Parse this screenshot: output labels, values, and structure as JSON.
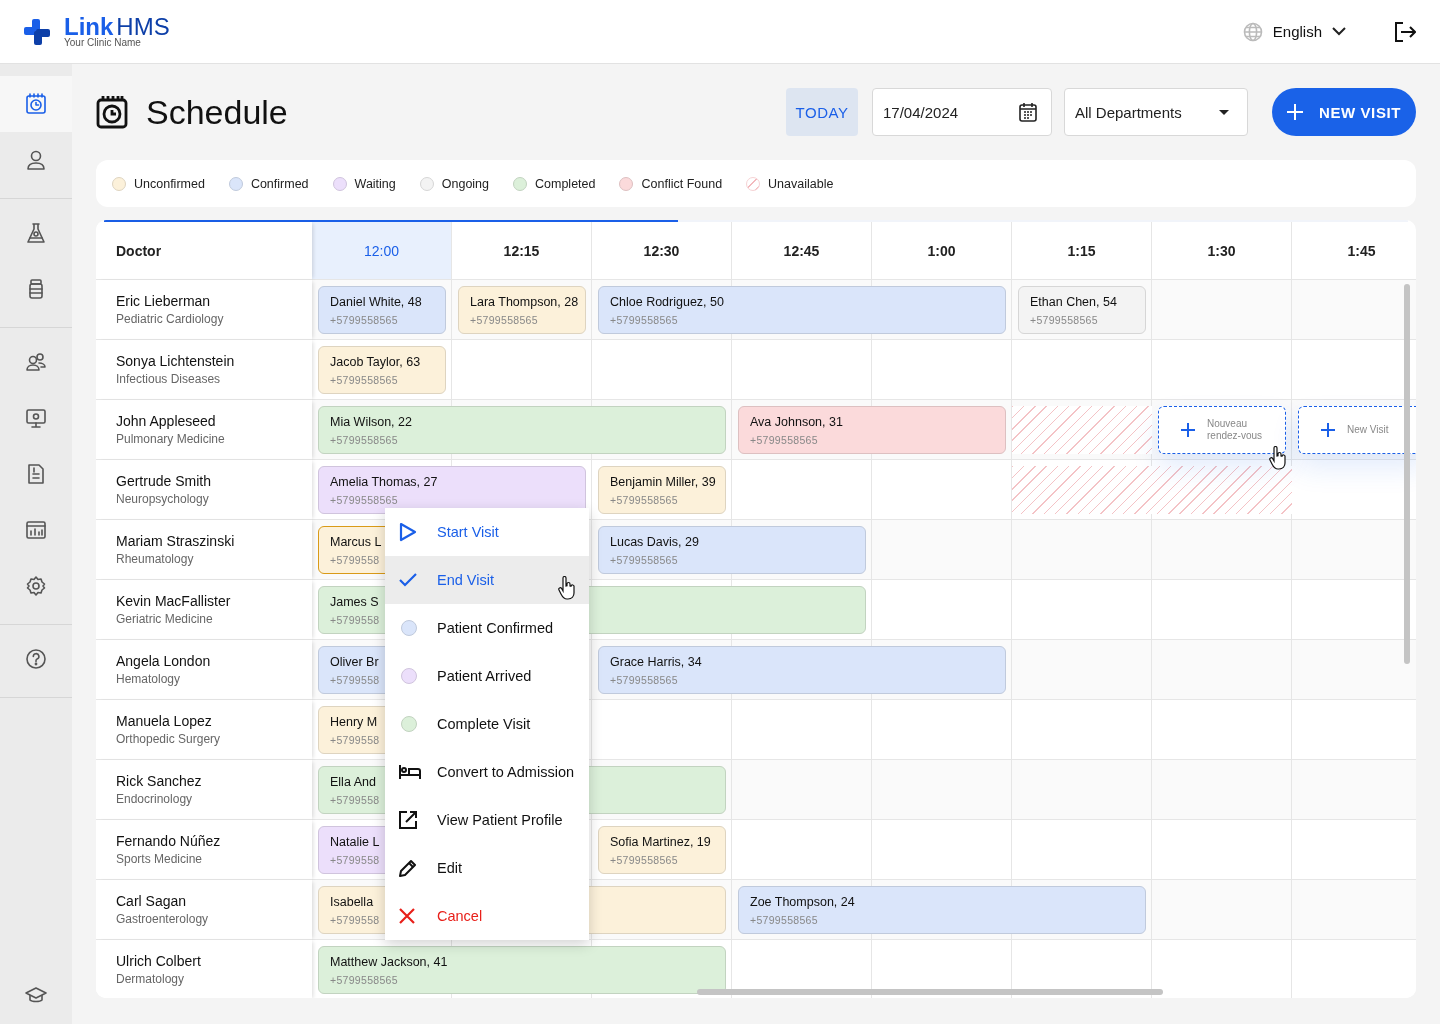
{
  "brand": {
    "name": "Link",
    "suffix": "HMS",
    "subtitle": "Your Clinic Name"
  },
  "header": {
    "language": "English"
  },
  "sidebar": {
    "groups": [
      [
        {
          "kind": "schedule",
          "selected": true
        },
        {
          "kind": "patients",
          "selected": false
        }
      ],
      [
        {
          "kind": "lab",
          "selected": false
        },
        {
          "kind": "medicine",
          "selected": false
        }
      ],
      [
        {
          "kind": "staff",
          "selected": false
        },
        {
          "kind": "monitor",
          "selected": false
        },
        {
          "kind": "billing",
          "selected": false
        },
        {
          "kind": "reports",
          "selected": false
        },
        {
          "kind": "settings",
          "selected": false
        }
      ],
      [
        {
          "kind": "help",
          "selected": false
        }
      ]
    ],
    "footer": {
      "kind": "academy"
    }
  },
  "page": {
    "title": "Schedule",
    "today_button": "TODAY",
    "date": "17/04/2024",
    "department": "All Departments",
    "new_visit_button": "NEW VISIT"
  },
  "legend": [
    {
      "kind": "solid",
      "color": "#fcf1da",
      "label": "Unconfirmed"
    },
    {
      "kind": "solid",
      "color": "#dae5fa",
      "label": "Confirmed"
    },
    {
      "kind": "solid",
      "color": "#ecdffb",
      "label": "Waiting"
    },
    {
      "kind": "solid",
      "color": "#f3f3f3",
      "label": "Ongoing"
    },
    {
      "kind": "solid",
      "color": "#dcf0da",
      "label": "Completed"
    },
    {
      "kind": "solid",
      "color": "#fbdadb",
      "label": "Conflict Found"
    },
    {
      "kind": "hatched",
      "label": "Unavailable"
    }
  ],
  "schedule": {
    "progress": {
      "level": 0.44
    },
    "doctor_column": "Doctor",
    "columns": [
      {
        "label": "12:00",
        "selected": true
      },
      {
        "label": "12:15",
        "selected": false
      },
      {
        "label": "12:30",
        "selected": false
      },
      {
        "label": "12:45",
        "selected": false
      },
      {
        "label": "1:00",
        "selected": false
      },
      {
        "label": "1:15",
        "selected": false
      },
      {
        "label": "1:30",
        "selected": false
      },
      {
        "label": "1:45",
        "selected": false
      }
    ],
    "rows": [
      {
        "doctor": "Eric Lieberman",
        "specialty": "Pediatric Cardiology",
        "cells": [
          {
            "kind": "appointment",
            "color": "#dae5fa",
            "patient": "Daniel White, 48",
            "phone": "+5799558565",
            "selected": false
          },
          {
            "kind": "appointment",
            "color": "#fcf1da",
            "patient": "Lara Thompson, 28",
            "phone": "+5799558565",
            "selected": false
          },
          {
            "kind": "appointment",
            "color": "#dae5fa",
            "patient": "Chloe Rodriguez, 50",
            "phone": "+5799558565",
            "selected": false
          },
          {
            "kind": "continued"
          },
          {
            "kind": "continued"
          },
          {
            "kind": "appointment",
            "color": "#f3f3f3",
            "patient": "Ethan Chen, 54",
            "phone": "+5799558565",
            "selected": false
          }
        ]
      },
      {
        "doctor": "Sonya Lichtenstein",
        "specialty": "Infectious Diseases",
        "cells": [
          {
            "kind": "appointment",
            "color": "#fcf1da",
            "patient": "Jacob Taylor, 63",
            "phone": "+5799558565",
            "selected": false
          }
        ]
      },
      {
        "doctor": "John Appleseed",
        "specialty": "Pulmonary Medicine",
        "cells": [
          {
            "kind": "appointment",
            "color": "#dcf0da",
            "patient": "Mia Wilson, 22",
            "phone": "+5799558565",
            "selected": false
          },
          {
            "kind": "continued"
          },
          {
            "kind": "continued"
          },
          {
            "kind": "appointment",
            "color": "#fbdadb",
            "patient": "Ava Johnson, 31",
            "phone": "+5799558565",
            "selected": false
          },
          {
            "kind": "continued"
          },
          {
            "kind": "unavailable"
          },
          {
            "kind": "new",
            "label": "Nouveau rendez-vous"
          },
          {
            "kind": "new",
            "label": "New Visit"
          }
        ]
      },
      {
        "doctor": "Gertrude Smith",
        "specialty": "Neuropsychology",
        "cells": [
          {
            "kind": "appointment",
            "color": "#ecdffb",
            "patient": "Amelia Thomas, 27",
            "phone": "+5799558565",
            "selected": false
          },
          {
            "kind": "continued"
          },
          {
            "kind": "appointment",
            "color": "#fcf1da",
            "patient": "Benjamin Miller, 39",
            "phone": "+5799558565",
            "selected": false
          },
          {
            "kind": "empty"
          },
          {
            "kind": "empty"
          },
          {
            "kind": "unavailable"
          },
          {
            "kind": "continued"
          }
        ]
      },
      {
        "doctor": "Mariam Straszinski",
        "specialty": "Rheumatology",
        "cells": [
          {
            "kind": "appointment",
            "color": "#fcf1da",
            "patient": "Marcus L",
            "phone": "+5799558",
            "selected": true
          },
          {
            "kind": "continued"
          },
          {
            "kind": "appointment",
            "color": "#dae5fa",
            "patient": "Lucas Davis, 29",
            "phone": "+5799558565",
            "selected": false
          },
          {
            "kind": "continued"
          }
        ]
      },
      {
        "doctor": "Kevin MacFallister",
        "specialty": "Geriatric Medicine",
        "cells": [
          {
            "kind": "appointment",
            "color": "#dcf0da",
            "patient": "James S",
            "phone": "+5799558",
            "selected": false
          },
          {
            "kind": "continued"
          },
          {
            "kind": "continued"
          },
          {
            "kind": "continued"
          }
        ]
      },
      {
        "doctor": "Angela London",
        "specialty": "Hematology",
        "cells": [
          {
            "kind": "appointment",
            "color": "#dae5fa",
            "patient": "Oliver Br",
            "phone": "+5799558",
            "selected": false
          },
          {
            "kind": "continued"
          },
          {
            "kind": "appointment",
            "color": "#dae5fa",
            "patient": "Grace Harris, 34",
            "phone": "+5799558565",
            "selected": false
          },
          {
            "kind": "continued"
          },
          {
            "kind": "continued"
          }
        ]
      },
      {
        "doctor": "Manuela Lopez",
        "specialty": "Orthopedic Surgery",
        "cells": [
          {
            "kind": "appointment",
            "color": "#fcf1da",
            "patient": "Henry M",
            "phone": "+5799558",
            "selected": false
          },
          {
            "kind": "continued"
          }
        ]
      },
      {
        "doctor": "Rick Sanchez",
        "specialty": "Endocrinology",
        "cells": [
          {
            "kind": "appointment",
            "color": "#dcf0da",
            "patient": "Ella And",
            "phone": "+5799558",
            "selected": false
          },
          {
            "kind": "continued"
          },
          {
            "kind": "continued"
          }
        ]
      },
      {
        "doctor": "Fernando Núñez",
        "specialty": "Sports Medicine",
        "cells": [
          {
            "kind": "appointment",
            "color": "#ecdffb",
            "patient": "Natalie L",
            "phone": "+5799558",
            "selected": false
          },
          {
            "kind": "continued"
          },
          {
            "kind": "appointment",
            "color": "#fcf1da",
            "patient": "Sofia Martinez, 19",
            "phone": "+5799558565",
            "selected": false
          }
        ]
      },
      {
        "doctor": "Carl Sagan",
        "specialty": "Gastroenterology",
        "cells": [
          {
            "kind": "appointment",
            "color": "#fcf1da",
            "patient": "Isabella",
            "phone": "+5799558",
            "selected": false
          },
          {
            "kind": "continued"
          },
          {
            "kind": "continued"
          },
          {
            "kind": "appointment",
            "color": "#dae5fa",
            "patient": "Zoe Thompson, 24",
            "phone": "+5799558565",
            "selected": false
          },
          {
            "kind": "continued"
          },
          {
            "kind": "continued"
          }
        ]
      },
      {
        "doctor": "Ulrich Colbert",
        "specialty": "Dermatology",
        "cells": [
          {
            "kind": "appointment",
            "color": "#dcf0da",
            "patient": "Matthew Jackson, 41",
            "phone": "+5799558565",
            "selected": false
          },
          {
            "kind": "continued"
          },
          {
            "kind": "continued"
          }
        ]
      }
    ]
  },
  "context_menu": {
    "items": [
      {
        "kind": "start",
        "label": "Start Visit",
        "selected": false
      },
      {
        "kind": "end",
        "label": "End Visit",
        "selected": true
      },
      {
        "kind": "status",
        "color": "#dae5fa",
        "label": "Patient Confirmed",
        "selected": false
      },
      {
        "kind": "status",
        "color": "#ecdffb",
        "label": "Patient Arrived",
        "selected": false
      },
      {
        "kind": "status",
        "color": "#dcf0da",
        "label": "Complete Visit",
        "selected": false
      },
      {
        "kind": "admission",
        "label": "Convert to Admission",
        "selected": false
      },
      {
        "kind": "profile",
        "label": "View Patient Profile",
        "selected": false
      },
      {
        "kind": "edit",
        "label": "Edit",
        "selected": false
      },
      {
        "kind": "cancel",
        "label": "Cancel",
        "selected": false
      }
    ]
  }
}
